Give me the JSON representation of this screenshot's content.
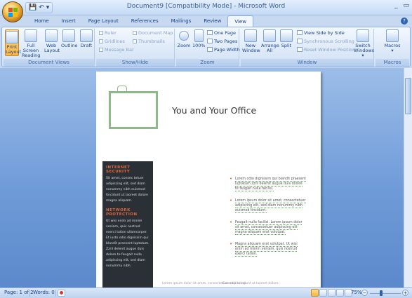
{
  "window": {
    "title": "Document9 [Compatibility Mode] - Microsoft Word",
    "controls": {
      "minimize": "_",
      "restore": "▭"
    }
  },
  "quick_access": {
    "save_icon": "save-icon",
    "undo": "↶",
    "dropdown": "▾"
  },
  "tabs": [
    "Home",
    "Insert",
    "Page Layout",
    "References",
    "Mailings",
    "Review",
    "View"
  ],
  "active_tab": "View",
  "help": "?",
  "ribbon": {
    "document_views": {
      "label": "Document Views",
      "buttons": [
        {
          "line1": "Print",
          "line2": "Layout",
          "active": true
        },
        {
          "line1": "Full Screen",
          "line2": "Reading",
          "active": false
        },
        {
          "line1": "Web",
          "line2": "Layout",
          "active": false
        },
        {
          "line1": "Outline",
          "line2": "",
          "active": false
        },
        {
          "line1": "Draft",
          "line2": "",
          "active": false
        }
      ]
    },
    "show_hide": {
      "label": "Show/Hide",
      "ruler": "Ruler",
      "gridlines": "Gridlines",
      "message_bar": "Message Bar",
      "document_map": "Document Map",
      "thumbnails": "Thumbnails"
    },
    "zoom": {
      "label": "Zoom",
      "zoom_btn": "Zoom",
      "hundred_btn": "100%",
      "one_page": "One Page",
      "two_pages": "Two Pages",
      "page_width": "Page Width"
    },
    "window": {
      "label": "Window",
      "new_window": [
        "New",
        "Window"
      ],
      "arrange_all": [
        "Arrange",
        "All"
      ],
      "split": "Split",
      "view_side_by_side": "View Side by Side",
      "synchronous_scrolling": "Synchronous Scrolling",
      "reset_window_position": "Reset Window Position",
      "switch_windows": [
        "Switch",
        "Windows ▾"
      ]
    },
    "macros": {
      "label": "Macros",
      "button": "Macros",
      "arrow": "▾"
    }
  },
  "document": {
    "title": "You and Your Office",
    "sidebar": {
      "heading1": "INTERNET SECURITY",
      "text1": "Sit amet, consec tetuer adipiscing elit, sed diam nonummy nibh euismod tincidunt ut laoreet dolore magna aliquam.",
      "heading2": "NETWORK PROTECTION",
      "text2": "Ut wisi enim ad minim veniam, quis nostrud exerci tation ullamcorper. Et iusto odio dignissim qui blandit praesent luptatum. Zzril delenit augue duis dolore te feugait nulla adipiscing elit, sed diam nonummy nibh."
    },
    "bullets": [
      "Lorem odio dignissim qui blandit praesent luptatum zzril delenit augue duis dolore te feugait nulla facilisi.",
      "Lorem ipsum dolor sit amet, consectetuer adipiscing elit, sed diam nonummy nibh euismod tincidunt.",
      "Feugait nulla facilisi. Lorem ipsum dolor sit amet, consectetuer adipiscing elit magna aliquam erat volutpat.",
      "Magna aliquam erat volutpat. Ut wisi enim ad minim veniam, quis nostrud exerci tation."
    ],
    "footer_left": "Lorem ipsum dolor sit amet, consectetuer adipiscing.",
    "footer_right": "Euismod tincidunt ut laoreet dolore."
  },
  "status": {
    "page": "Page: 1 of 2",
    "words": "Words: 0",
    "zoom": "75%",
    "zoom_level": 0.37,
    "zoom_minus": "−",
    "zoom_plus": "+"
  }
}
